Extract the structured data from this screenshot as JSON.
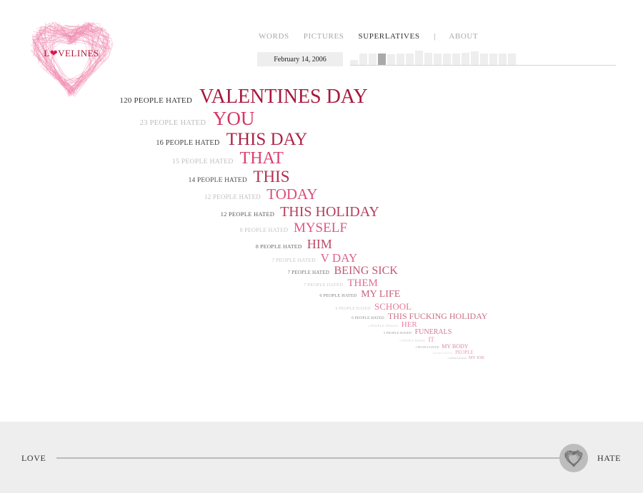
{
  "logo": {
    "pre": "L",
    "heart": "❤",
    "post": "VELINES",
    "heart_color": "#e4154a",
    "icon": "scribble-heart-icon"
  },
  "nav": {
    "items": [
      "WORDS",
      "PICTURES",
      "SUPERLATIVES",
      "ABOUT"
    ],
    "active": "SUPERLATIVES",
    "separator": "|"
  },
  "date": "February 14, 2006",
  "timeline": {
    "selected_index": 3,
    "levels": [
      0.35,
      0.8,
      0.8,
      0.8,
      0.75,
      0.8,
      0.8,
      1.0,
      0.85,
      0.8,
      0.8,
      0.8,
      0.85,
      0.95,
      0.8,
      0.8,
      0.8,
      0.8
    ]
  },
  "words": [
    {
      "count": "120 PEOPLE HATED",
      "word": "VALENTINES DAY"
    },
    {
      "count": "23 PEOPLE HATED",
      "word": "YOU"
    },
    {
      "count": "16 PEOPLE HATED",
      "word": "THIS DAY"
    },
    {
      "count": "15 PEOPLE HATED",
      "word": "THAT"
    },
    {
      "count": "14 PEOPLE HATED",
      "word": "THIS"
    },
    {
      "count": "12 PEOPLE HATED",
      "word": "TODAY"
    },
    {
      "count": "12 PEOPLE HATED",
      "word": "THIS HOLIDAY"
    },
    {
      "count": "8 PEOPLE HATED",
      "word": "MYSELF"
    },
    {
      "count": "8 PEOPLE HATED",
      "word": "HIM"
    },
    {
      "count": "7 PEOPLE HATED",
      "word": "V DAY"
    },
    {
      "count": "7 PEOPLE HATED",
      "word": "BEING SICK"
    },
    {
      "count": "7 PEOPLE HATED",
      "word": "THEM"
    },
    {
      "count": "6 PEOPLE HATED",
      "word": "MY LIFE"
    },
    {
      "count": "6 PEOPLE HATED",
      "word": "SCHOOL"
    },
    {
      "count": "6 PEOPLE HATED",
      "word": "THIS FUCKING HOLIDAY"
    },
    {
      "count": "5 PEOPLE HATED",
      "word": "HER"
    },
    {
      "count": "5 PEOPLE HATED",
      "word": "FUNERALS"
    },
    {
      "count": "5 PEOPLE HATED",
      "word": "IT"
    },
    {
      "count": "5 PEOPLE HATED",
      "word": "MY BODY"
    },
    {
      "count": "5 PEOPLE HATED",
      "word": "PEOPLE"
    },
    {
      "count": "5 PEOPLE HATED",
      "word": "MY JOB"
    }
  ],
  "slider": {
    "left_label": "LOVE",
    "right_label": "HATE",
    "value": 0.99,
    "knob_icon": "scribble-heart-icon"
  },
  "colors": {
    "dark_red": "#a8173c",
    "pink": "#d62f63",
    "light_pink": "#e07a9b",
    "footer_bg": "#eeeeee"
  }
}
